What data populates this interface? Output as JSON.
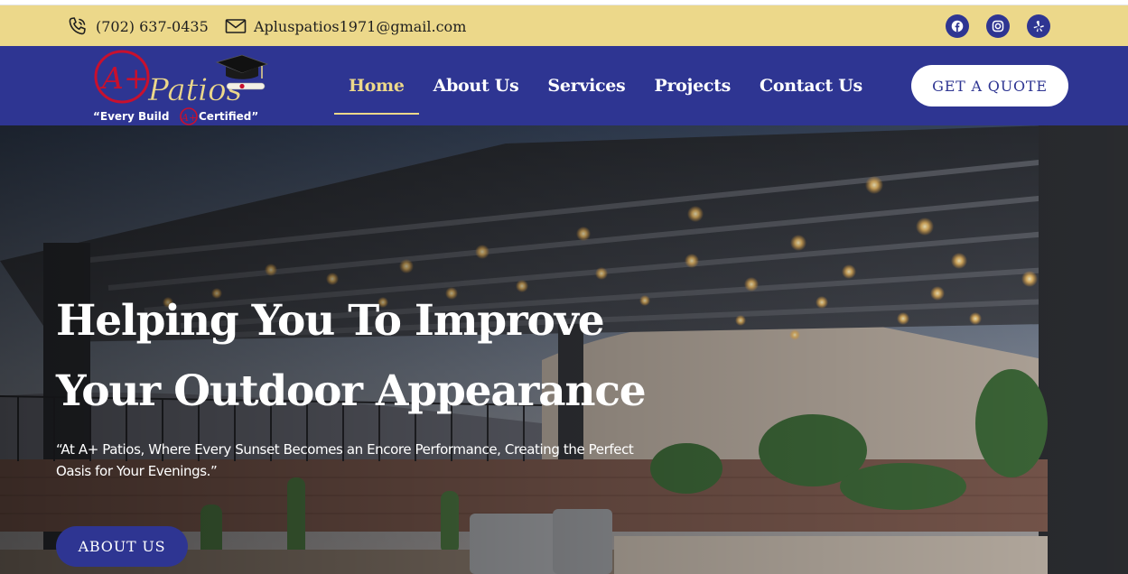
{
  "colors": {
    "brand_blue": "#2e3592",
    "accent_gold": "#ecd88a",
    "text_dark": "#1f1f1f",
    "logo_red": "#c8102e"
  },
  "topbar": {
    "phone": {
      "icon": "phone-icon",
      "text": "(702) 637-0435"
    },
    "email": {
      "icon": "mail-icon",
      "text": "Apluspatios1971@gmail.com"
    },
    "socials": [
      {
        "name": "facebook",
        "icon": "facebook-icon"
      },
      {
        "name": "instagram",
        "icon": "instagram-icon"
      },
      {
        "name": "yelp",
        "icon": "yelp-icon"
      }
    ]
  },
  "logo": {
    "mark": "A+",
    "name": "Patios",
    "tagline_left": "“Every Build",
    "tagline_mark": "A+",
    "tagline_right": "Certified”"
  },
  "nav": {
    "items": [
      {
        "label": "Home",
        "active": true
      },
      {
        "label": "About Us",
        "active": false
      },
      {
        "label": "Services",
        "active": false
      },
      {
        "label": "Projects",
        "active": false
      },
      {
        "label": "Contact Us",
        "active": false
      }
    ],
    "cta_label": "GET A QUOTE"
  },
  "hero": {
    "title_line1": "Helping You To Improve",
    "title_line2": "Your Outdoor Appearance",
    "subtitle": "“At A+ Patios, Where Every Sunset Becomes an Encore Performance, Creating the Perfect Oasis for Your Evenings.”",
    "button_label": "ABOUT US"
  }
}
